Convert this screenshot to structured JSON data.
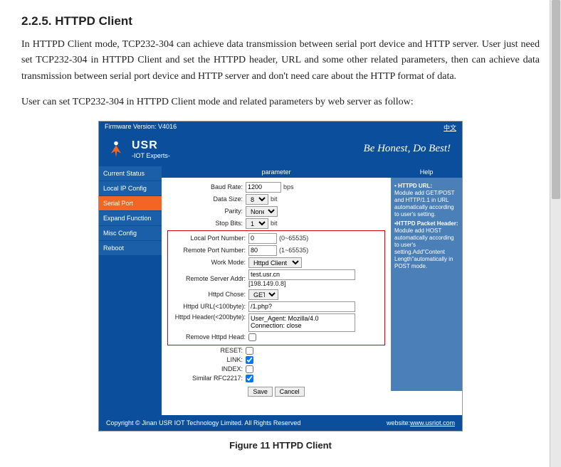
{
  "doc": {
    "section_number": "2.2.5. HTTPD Client",
    "para1": "In HTTPD Client mode, TCP232-304 can achieve data transmission between serial port device and HTTP server. User just need set TCP232-304 in HTTPD Client and set the HTTPD header, URL and some other related parameters, then can achieve data transmission between serial port device and HTTP server and don't need care about the HTTP format of data.",
    "para2": "User can set TCP232-304 in HTTPD Client mode and related parameters by web server as follow:",
    "figure_caption": "Figure 11 HTTPD Client"
  },
  "wp": {
    "firmware_label": "Firmware Version:",
    "firmware_version": "V4016",
    "lang_link": "中文",
    "brand": "USR",
    "brand_sub": "-IOT Experts-",
    "slogan": "Be Honest, Do Best!",
    "nav": [
      {
        "label": "Current Status"
      },
      {
        "label": "Local IP Config"
      },
      {
        "label": "Serial Port"
      },
      {
        "label": "Expand Function"
      },
      {
        "label": "Misc Config"
      },
      {
        "label": "Reboot"
      }
    ],
    "form_header": "parameter",
    "help_header": "Help",
    "form": {
      "baud_label": "Baud Rate:",
      "baud_value": "1200",
      "baud_unit": "bps",
      "data_label": "Data Size:",
      "data_value": "8",
      "data_unit": "bit",
      "parity_label": "Parity:",
      "parity_value": "None",
      "stop_label": "Stop Bits:",
      "stop_value": "1",
      "stop_unit": "bit",
      "local_port_label": "Local Port Number:",
      "local_port_value": "0",
      "local_port_hint": "(0~65535)",
      "remote_port_label": "Remote Port Number:",
      "remote_port_value": "80",
      "remote_port_hint": "(1~65535)",
      "work_mode_label": "Work Mode:",
      "work_mode_value": "Httpd Client",
      "remote_addr_label": "Remote Server Addr:",
      "remote_addr_value": "test.usr.cn",
      "remote_addr_ip": "[198.149.0.8]",
      "httpd_chose_label": "Httpd Chose:",
      "httpd_chose_value": "GET",
      "httpd_url_label": "Httpd URL(<100byte):",
      "httpd_url_value": "/1.php?",
      "httpd_header_label": "Httpd Header(<200byte):",
      "httpd_header_value": "User_Agent: Mozilla/4.0\nConnection: close",
      "remove_head_label": "Remove Httpd Head:",
      "reset_label": "RESET:",
      "link_label": "LINK:",
      "index_label": "INDEX:",
      "rfc2217_label": "Similar RFC2217:",
      "save_btn": "Save",
      "cancel_btn": "Cancel"
    },
    "help": {
      "t1": "HTTPD URL:",
      "b1": "Module add GET/POST and HTTP/1.1 in URL automatically according to user's setting.",
      "t2": "•HTTPD Packet Header:",
      "b2": "Module add HOST automatically according to user's setting.Add\"Content Length\"automatically in POST mode."
    },
    "footer": {
      "copyright": "Copyright © Jinan USR IOT Technology Limited. All Rights Reserved",
      "website_label": "website:",
      "website_url": "www.usriot.com"
    }
  }
}
